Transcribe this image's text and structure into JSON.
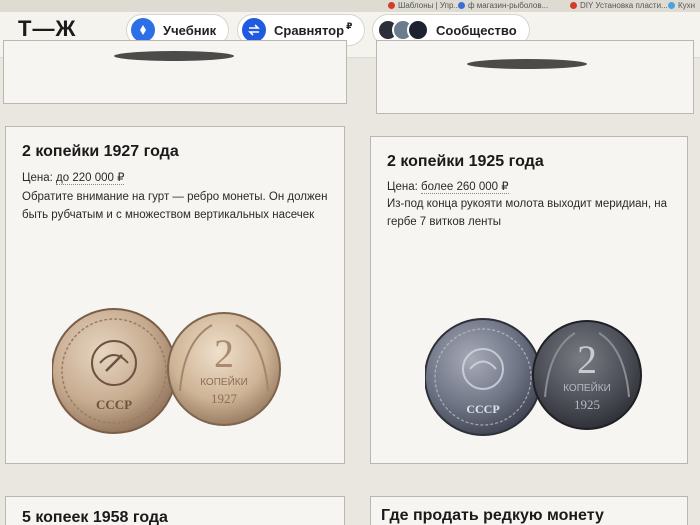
{
  "bookmarks": [
    {
      "label": "Шаблоны | Упр...",
      "color": "#d43c2a"
    },
    {
      "label": "ф магазин-рыболов...",
      "color": "#3c6ed4"
    },
    {
      "label": "DIY Установка пласти...",
      "color": "#d43c2a"
    },
    {
      "label": "Кухн",
      "color": "#4aa3df"
    }
  ],
  "header": {
    "logo": "Т—Ж",
    "nav": [
      {
        "label": "Учебник",
        "icon": "book-icon",
        "icon_color": "#2c6fe6"
      },
      {
        "label": "Сравнятор",
        "suffix": "₽",
        "icon": "arrows-icon",
        "icon_color": "#1f5be0"
      },
      {
        "label": "Сообщество",
        "icon": "community-avatars-icon"
      }
    ]
  },
  "cards": [
    {
      "title": "2 копейки 1927 года",
      "price_label": "Цена: ",
      "price_value": "до 220 000 ₽",
      "description": "Обратите внимание на гурт — ребро монеты. Он должен быть рубчатым и с множеством вертикальных насечек",
      "coin_year": "1927",
      "coin_denomination": "2",
      "coin_word": "КОПЕЙКИ",
      "coin_tone": "bronze"
    },
    {
      "title": "2 копейки 1925 года",
      "price_label": "Цена: ",
      "price_value": "более 260 000 ₽",
      "description": "Из-под конца рукояти молота выходит меридиан, на гербе 7 витков ленты",
      "coin_year": "1925",
      "coin_denomination": "2",
      "coin_word": "КОПЕЙКИ",
      "coin_tone": "dark"
    },
    {
      "title": "5 копеек 1958 года"
    },
    {
      "title": "Где продать редкую монету"
    }
  ],
  "coin_obverse_text": "СССР",
  "colors": {
    "background": "#e9e7e0",
    "card_background": "#f6f5f1",
    "accent_blue": "#2c6fe6"
  }
}
